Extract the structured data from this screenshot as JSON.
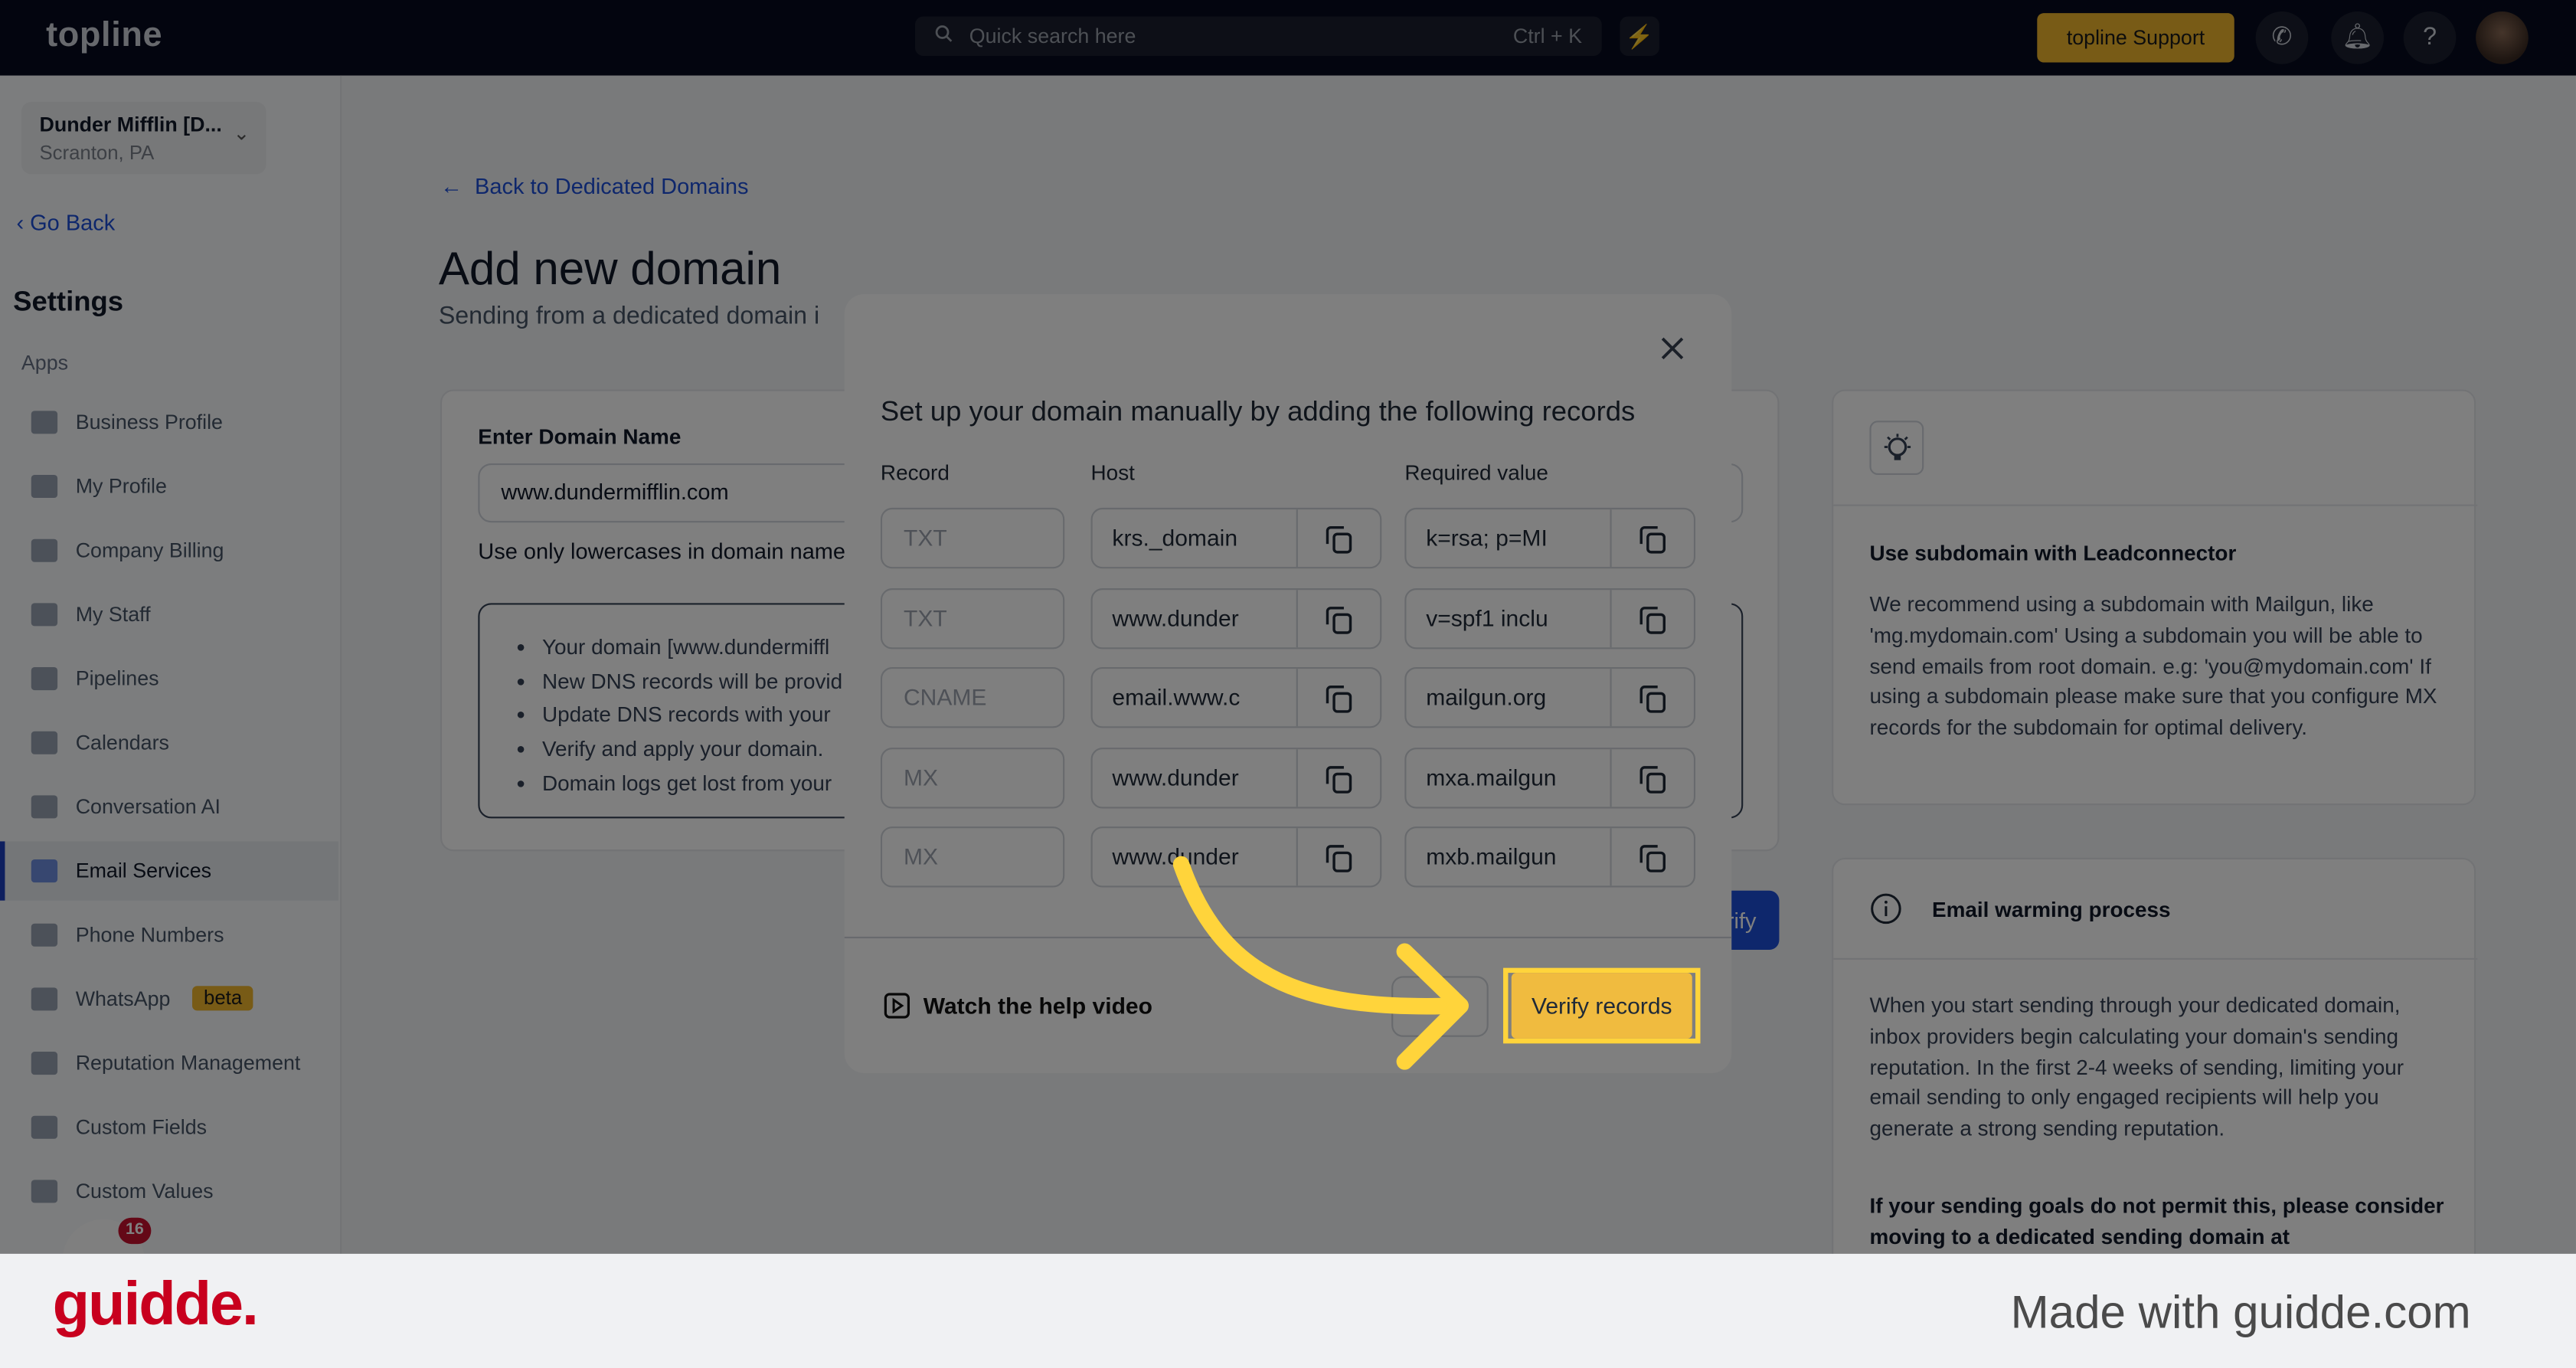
{
  "topbar": {
    "logo": "topline",
    "search_placeholder": "Quick search here",
    "search_shortcut": "Ctrl + K",
    "support_label": "topline Support",
    "icons": [
      "search-icon",
      "lightning-icon",
      "phone-icon",
      "bell-icon",
      "help-icon",
      "avatar"
    ]
  },
  "sidebar": {
    "account_name": "Dunder Mifflin [D...",
    "account_location": "Scranton, PA",
    "go_back": "Go Back",
    "settings_title": "Settings",
    "section": "Apps",
    "items": [
      {
        "label": "Business Profile"
      },
      {
        "label": "My Profile"
      },
      {
        "label": "Company Billing"
      },
      {
        "label": "My Staff"
      },
      {
        "label": "Pipelines"
      },
      {
        "label": "Calendars"
      },
      {
        "label": "Conversation AI"
      },
      {
        "label": "Email Services",
        "active": true
      },
      {
        "label": "Phone Numbers"
      },
      {
        "label": "WhatsApp",
        "badge": "beta"
      },
      {
        "label": "Reputation Management"
      },
      {
        "label": "Custom Fields"
      },
      {
        "label": "Custom Values"
      }
    ],
    "chat_badge": "16"
  },
  "main": {
    "back_link": "Back to Dedicated Domains",
    "title": "Add new domain",
    "subtitle": "Sending from a dedicated domain i",
    "domain_label": "Enter Domain Name",
    "domain_value": "www.dundermifflin.com",
    "helper": "Use only lowercases in domain name",
    "bullets": [
      "Your domain [www.dundermiffl",
      "New DNS records will be provid",
      "Update DNS records with your",
      "Verify and apply your domain.",
      "Domain logs get lost from your"
    ],
    "verify_label": "Verify"
  },
  "right": {
    "card1_title": "Use subdomain with Leadconnector",
    "card1_body": "We recommend using a subdomain with Mailgun, like 'mg.mydomain.com' Using a subdomain you will be able to send emails from root domain. e.g: 'you@mydomain.com' If using a subdomain please make sure that you configure MX records for the subdomain for optimal delivery.",
    "card2_title": "Email warming process",
    "card2_body": "When you start sending through your dedicated domain, inbox providers begin calculating your domain's sending reputation. In the first 2-4 weeks of sending, limiting your email sending to only engaged recipients will help you generate a strong sending reputation.",
    "card2_bold": "If your sending goals do not permit this, please consider moving to a dedicated sending domain at"
  },
  "modal": {
    "title": "Set up your domain manually by adding the following records",
    "headers": {
      "record": "Record",
      "host": "Host",
      "value": "Required value"
    },
    "rows": [
      {
        "record": "TXT",
        "host": "krs._domain",
        "value": "k=rsa; p=MI"
      },
      {
        "record": "TXT",
        "host": "www.dunder",
        "value": "v=spf1 inclu"
      },
      {
        "record": "CNAME",
        "host": "email.www.c",
        "value": "mailgun.org"
      },
      {
        "record": "MX",
        "host": "www.dunder",
        "value": "mxa.mailgun"
      },
      {
        "record": "MX",
        "host": "www.dunder",
        "value": "mxb.mailgun"
      }
    ],
    "help_link": "Watch the help video",
    "verify_button": "Verify records"
  },
  "footer": {
    "brand": "guidde.",
    "made_with": "Made with guidde.com"
  },
  "colors": {
    "highlight": "#ffd43b",
    "accent": "#1d4ed8",
    "verify": "#f0bb3f",
    "brand": "#c8001e"
  }
}
